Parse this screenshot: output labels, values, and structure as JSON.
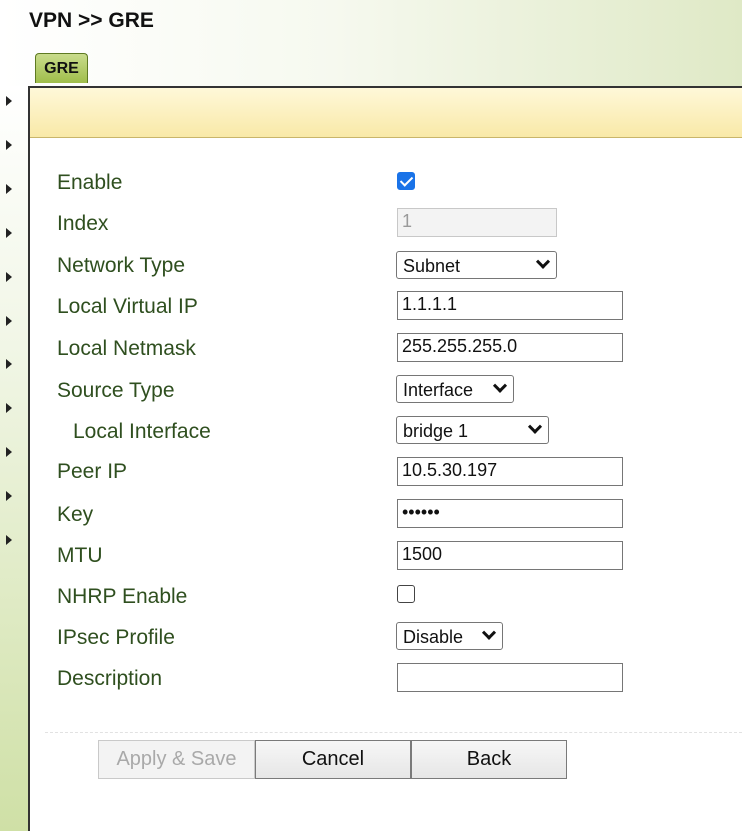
{
  "breadcrumb": "VPN >> GRE",
  "tab": {
    "label": "GRE"
  },
  "form": {
    "enable": {
      "label": "Enable",
      "checked": true
    },
    "index": {
      "label": "Index",
      "value": "1"
    },
    "network_type": {
      "label": "Network Type",
      "value": "Subnet"
    },
    "local_virtual_ip": {
      "label": "Local Virtual IP",
      "value": "1.1.1.1"
    },
    "local_netmask": {
      "label": "Local Netmask",
      "value": "255.255.255.0"
    },
    "source_type": {
      "label": "Source Type",
      "value": "Interface"
    },
    "local_interface": {
      "label": "Local Interface",
      "value": "bridge 1"
    },
    "peer_ip": {
      "label": "Peer IP",
      "value": "10.5.30.197"
    },
    "key": {
      "label": "Key",
      "value": "••••••"
    },
    "mtu": {
      "label": "MTU",
      "value": "1500"
    },
    "nhrp_enable": {
      "label": "NHRP Enable",
      "checked": false
    },
    "ipsec_profile": {
      "label": "IPsec Profile",
      "value": "Disable"
    },
    "description": {
      "label": "Description",
      "value": ""
    }
  },
  "buttons": {
    "apply_save": "Apply & Save",
    "cancel": "Cancel",
    "back": "Back"
  },
  "colors": {
    "label_text": "#2f4f1f",
    "tab_green": "#9fbd4a",
    "panel_header": "#f9e9a8",
    "checkbox_checked": "#1a73e8"
  }
}
